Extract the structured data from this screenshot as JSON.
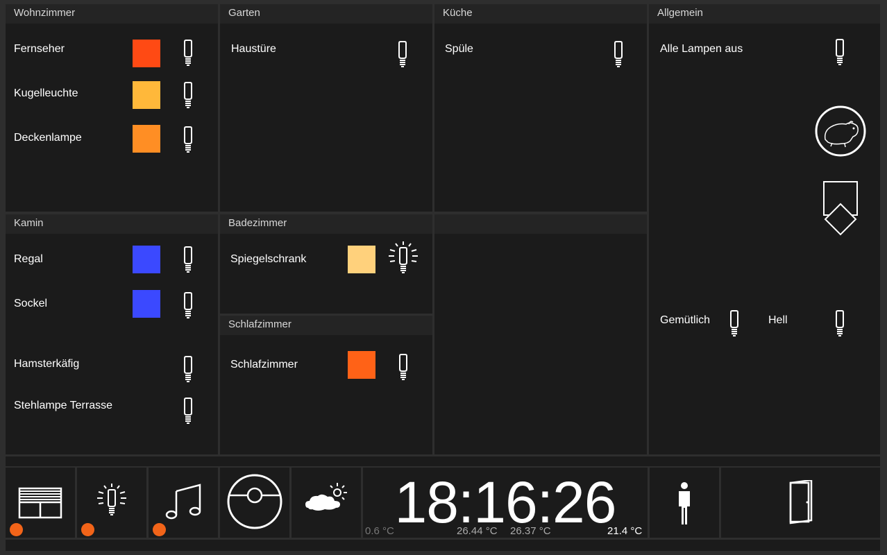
{
  "rooms": {
    "wohnzimmer": {
      "title": "Wohnzimmer",
      "items": [
        {
          "label": "Fernseher",
          "color": "#ff4a14"
        },
        {
          "label": "Kugelleuchte",
          "color": "#ffb83a"
        },
        {
          "label": "Deckenlampe",
          "color": "#ff8e24"
        }
      ]
    },
    "garten": {
      "title": "Garten",
      "items": [
        {
          "label": "Haustüre"
        }
      ]
    },
    "kueche": {
      "title": "Küche",
      "items": [
        {
          "label": "Spüle"
        }
      ]
    },
    "allgemein": {
      "title": "Allgemein",
      "alle_lampen": "Alle Lampen aus",
      "scenes": [
        {
          "label": "Gemütlich"
        },
        {
          "label": "Hell"
        }
      ]
    },
    "kamin": {
      "title": "Kamin",
      "items": [
        {
          "label": "Regal",
          "color": "#3b49ff"
        },
        {
          "label": "Sockel",
          "color": "#3b49ff"
        },
        {
          "label": "Hamsterkäfig"
        },
        {
          "label": "Stehlampe Terrasse"
        }
      ]
    },
    "badezimmer": {
      "title": "Badezimmer",
      "items": [
        {
          "label": "Spiegelschrank",
          "color": "#ffd17c"
        }
      ]
    },
    "schlafzimmer": {
      "title": "Schlafzimmer",
      "items": [
        {
          "label": "Schlafzimmer",
          "color": "#ff6217"
        }
      ]
    }
  },
  "bottom_bar": {
    "clock": "18:16:26",
    "temp_outside": "0.6 °C",
    "temp_1": "26.44 °C",
    "temp_2": "26.37 °C",
    "temp_inside": "21.4 °C",
    "icons": [
      "blinds-icon",
      "light-icon",
      "music-icon",
      "robot-vacuum-icon",
      "weather-icon",
      "person-icon",
      "door-icon"
    ],
    "indicator_color": "#f26419"
  }
}
